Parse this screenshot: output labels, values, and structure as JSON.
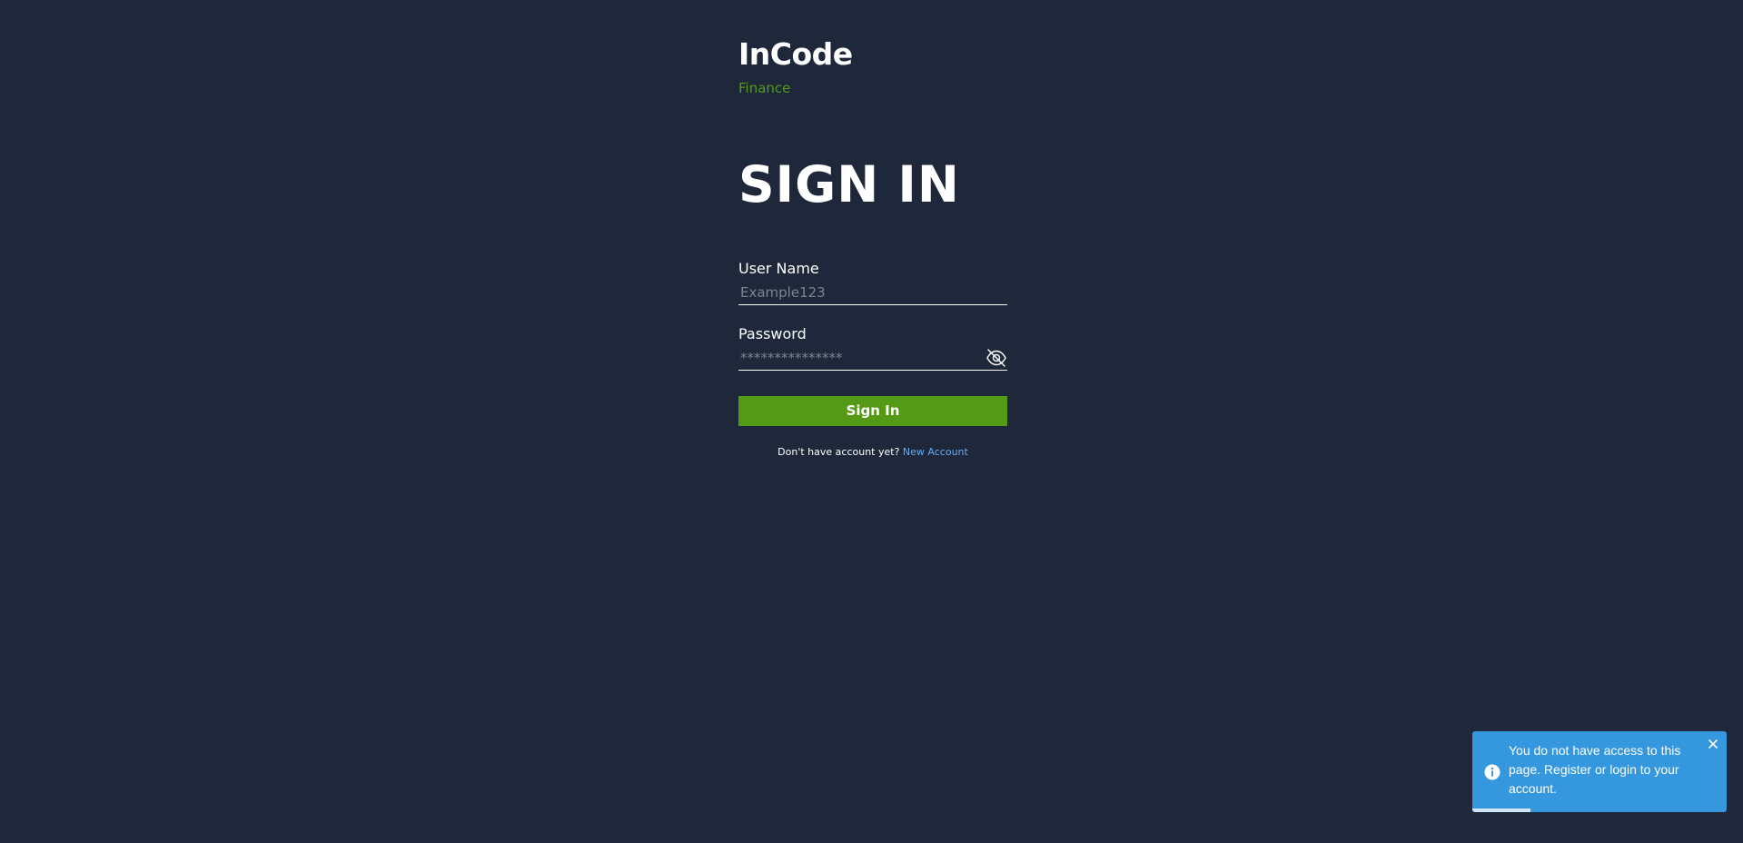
{
  "brand": {
    "title": "InCode",
    "subtitle": "Finance"
  },
  "heading": "SIGN IN",
  "form": {
    "username": {
      "label": "User Name",
      "placeholder": "Example123",
      "value": ""
    },
    "password": {
      "label": "Password",
      "placeholder": "***************",
      "value": "",
      "visibility_icon": "eye-slash-icon"
    },
    "submit_label": "Sign In"
  },
  "signup": {
    "prompt": "Don't have account yet?",
    "link_label": "New Account"
  },
  "toast": {
    "icon": "info-icon",
    "message": "You do not have access to this page. Register or login to your account.",
    "close_icon": "close-icon",
    "progress": 0.23,
    "background": "#3597dd"
  },
  "colors": {
    "background": "#1e283a",
    "accent_green": "#559a16",
    "subtitle_green": "#4f9a23",
    "link_blue": "#6aa9f0"
  }
}
